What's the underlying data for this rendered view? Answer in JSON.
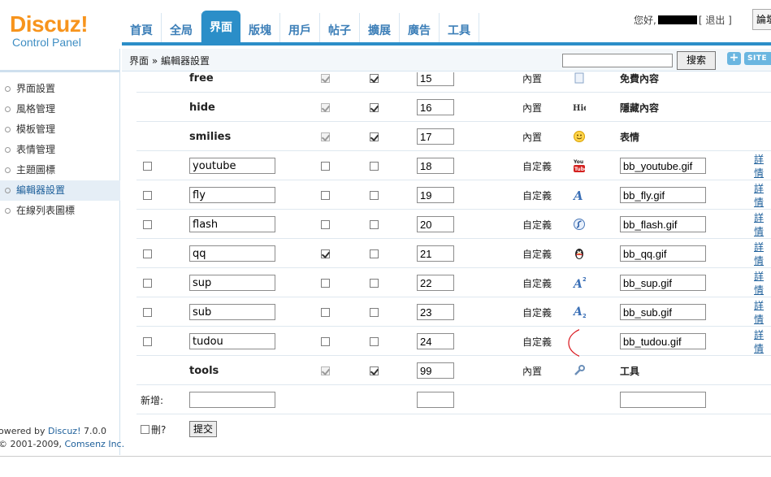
{
  "logo": {
    "main": "Discuz!",
    "sub": "Control Panel"
  },
  "nav": [
    "首頁",
    "全局",
    "界面",
    "版塊",
    "用戶",
    "帖子",
    "擴展",
    "廣告",
    "工具"
  ],
  "nav_active": 2,
  "user": {
    "greeting": "您好,",
    "logout": "[ 退出 ]",
    "forum_btn": "論壇"
  },
  "breadcrumb": "界面 » 編輯器設置",
  "search": {
    "value": "",
    "button": "搜索",
    "plus": "+",
    "site": "SITE"
  },
  "sidebar": {
    "items": [
      "界面設置",
      "風格管理",
      "模板管理",
      "表情管理",
      "主題圖標",
      "編輯器設置",
      "在線列表圖標"
    ],
    "active": 5,
    "footer_line1_prefix": "owered by ",
    "footer_line1_link": "Discuz!",
    "footer_line1_suffix": " 7.0.0",
    "footer_line2_prefix": "© 2001-2009, ",
    "footer_line2_link": "Comsenz Inc."
  },
  "rows": [
    {
      "builtin": true,
      "tag": "free",
      "c1": true,
      "c2": true,
      "order": "15",
      "type": "內置",
      "icon": "page-icon",
      "desc": "免費內容"
    },
    {
      "builtin": true,
      "tag": "hide",
      "c1": true,
      "c2": true,
      "order": "16",
      "type": "內置",
      "icon": "hide-icon",
      "desc": "隱藏內容"
    },
    {
      "builtin": true,
      "tag": "smilies",
      "c1": true,
      "c2": true,
      "order": "17",
      "type": "內置",
      "icon": "smiley-icon",
      "desc": "表情"
    },
    {
      "builtin": false,
      "tag": "youtube",
      "c1": false,
      "c2": false,
      "order": "18",
      "type": "自定義",
      "icon": "youtube-icon",
      "image": "bb_youtube.gif",
      "detail": "詳情"
    },
    {
      "builtin": false,
      "tag": "fly",
      "c1": false,
      "c2": false,
      "order": "19",
      "type": "自定義",
      "icon": "fly-text-icon",
      "image": "bb_fly.gif",
      "detail": "詳情"
    },
    {
      "builtin": false,
      "tag": "flash",
      "c1": false,
      "c2": false,
      "order": "20",
      "type": "自定義",
      "icon": "flash-icon",
      "image": "bb_flash.gif",
      "detail": "詳情"
    },
    {
      "builtin": false,
      "tag": "qq",
      "c1": true,
      "c2": false,
      "order": "21",
      "type": "自定義",
      "icon": "qq-penguin-icon",
      "image": "bb_qq.gif",
      "detail": "詳情"
    },
    {
      "builtin": false,
      "tag": "sup",
      "c1": false,
      "c2": false,
      "order": "22",
      "type": "自定義",
      "icon": "superscript-icon",
      "image": "bb_sup.gif",
      "detail": "詳情"
    },
    {
      "builtin": false,
      "tag": "sub",
      "c1": false,
      "c2": false,
      "order": "23",
      "type": "自定義",
      "icon": "subscript-icon",
      "image": "bb_sub.gif",
      "detail": "詳情"
    },
    {
      "builtin": false,
      "tag": "tudou",
      "c1": false,
      "c2": false,
      "order": "24",
      "type": "自定義",
      "icon": "broken-image-icon",
      "image": "bb_tudou.gif",
      "detail": "詳情"
    },
    {
      "builtin": true,
      "tag": "tools",
      "c1": true,
      "c2": true,
      "order": "99",
      "type": "內置",
      "icon": "wrench-icon",
      "desc": "工具"
    }
  ],
  "new_row": {
    "label": "新增:"
  },
  "footer_actions": {
    "delete_label": "刪?",
    "submit": "提交"
  },
  "colors": {
    "brand_orange": "#f7941d",
    "nav_blue": "#2b8ec8",
    "link_blue": "#1d5f9a",
    "annotation_red": "#d9141b"
  }
}
